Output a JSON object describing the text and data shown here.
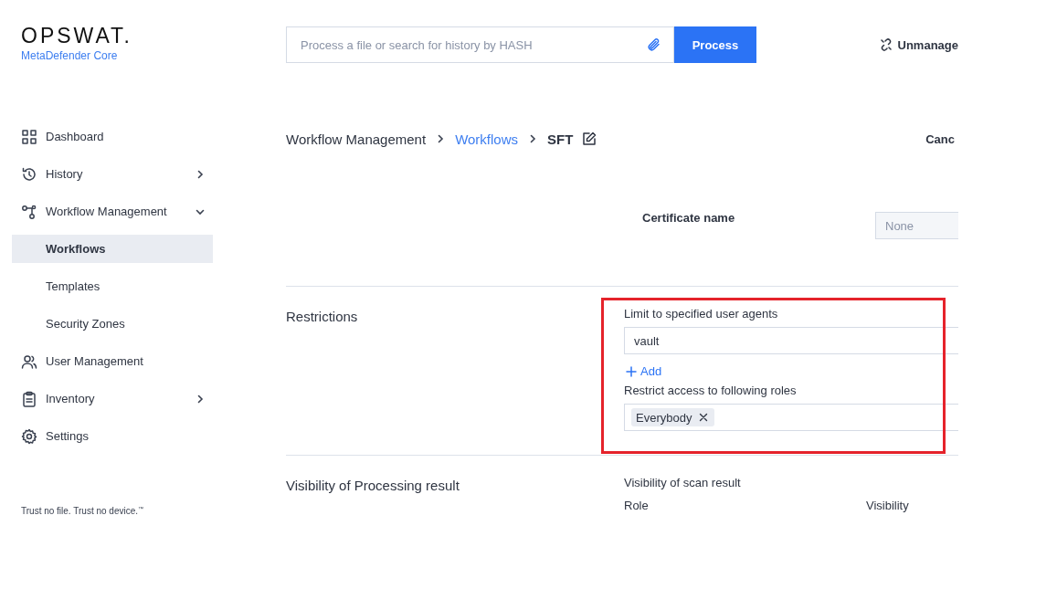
{
  "brand": {
    "logo": "OPSWAT.",
    "product": "MetaDefender Core",
    "tagline": "Trust no file. Trust no device.",
    "tagline_mark": "™"
  },
  "header": {
    "search": {
      "placeholder": "Process a file or search for history by HASH"
    },
    "process_button": "Process",
    "unmanage": "Unmanage"
  },
  "sidebar": {
    "items": [
      {
        "label": "Dashboard",
        "expandable": false
      },
      {
        "label": "History",
        "expandable": true,
        "expanded": false
      },
      {
        "label": "Workflow Management",
        "expandable": true,
        "expanded": true,
        "children": [
          {
            "label": "Workflows",
            "selected": true
          },
          {
            "label": "Templates",
            "selected": false
          },
          {
            "label": "Security Zones",
            "selected": false
          }
        ]
      },
      {
        "label": "User Management",
        "expandable": false
      },
      {
        "label": "Inventory",
        "expandable": true,
        "expanded": false
      },
      {
        "label": "Settings",
        "expandable": false
      }
    ]
  },
  "breadcrumb": {
    "items": [
      "Workflow Management",
      "Workflows",
      "SFT"
    ],
    "cancel": "Canc"
  },
  "certificate": {
    "label": "Certificate name",
    "placeholder": "None"
  },
  "restrictions": {
    "title": "Restrictions",
    "user_agents_label": "Limit to specified user agents",
    "user_agents": [
      "vault"
    ],
    "add": "Add",
    "roles_label": "Restrict access to following roles",
    "roles": [
      "Everybody"
    ],
    "highlighted": true
  },
  "visibility": {
    "title": "Visibility of Processing result",
    "label": "Visibility of scan result",
    "columns": [
      "Role",
      "Visibility"
    ]
  }
}
